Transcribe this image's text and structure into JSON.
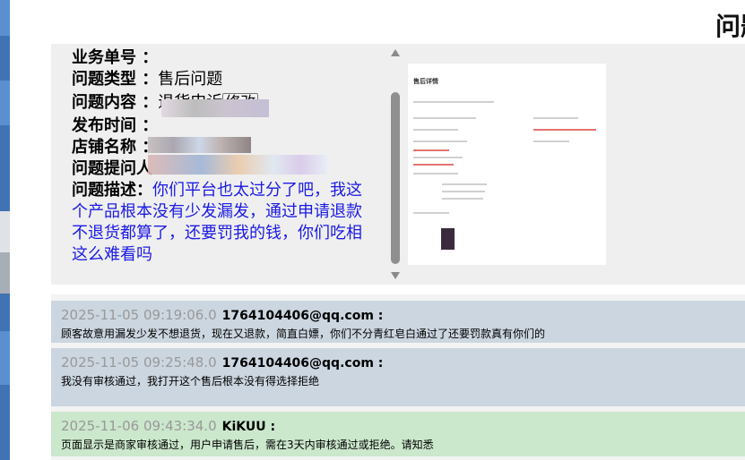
{
  "page": {
    "heading": "问题"
  },
  "info": {
    "order_no": {
      "label": "业务单号 ：",
      "value": ""
    },
    "issue_type": {
      "label": "问题类型 ：",
      "value": "售后问题"
    },
    "issue_content": {
      "label": "问题内容 ：",
      "value": "退货申诉",
      "edit_label": "修改"
    },
    "publish_time": {
      "label": "发布时间 ：",
      "value": ""
    },
    "shop_name": {
      "label": "店铺名称 ：",
      "value": ""
    },
    "submitter": {
      "label": "问题提问人",
      "value": ""
    },
    "description": {
      "label": "问题描述：",
      "text": "你们平台也太过分了吧，我这个产品根本没有少发漏发，通过申请退款不退货都算了，还要罚我的钱，你们吃相这么难看吗"
    }
  },
  "attachment": {
    "title": "售后详情"
  },
  "messages": [
    {
      "time": "2025-11-05 09:19:06.0",
      "user": "1764104406@qq.com :",
      "text": "顾客故意用漏发少发不想退货，现在又退款，简直白嫖，你们不分青红皂白通过了还要罚款真有你们的",
      "style": "grey"
    },
    {
      "time": "2025-11-05 09:25:48.0",
      "user": "1764104406@qq.com :",
      "text": "我没有审核通过，我打开这个售后根本没有得选择拒绝",
      "style": "grey"
    },
    {
      "time": "2025-11-06 09:43:34.0",
      "user": "KiKUU :",
      "text": "页面显示是商家审核通过，用户申请售后，需在3天内审核通过或拒绝。请知悉",
      "style": "green"
    }
  ]
}
